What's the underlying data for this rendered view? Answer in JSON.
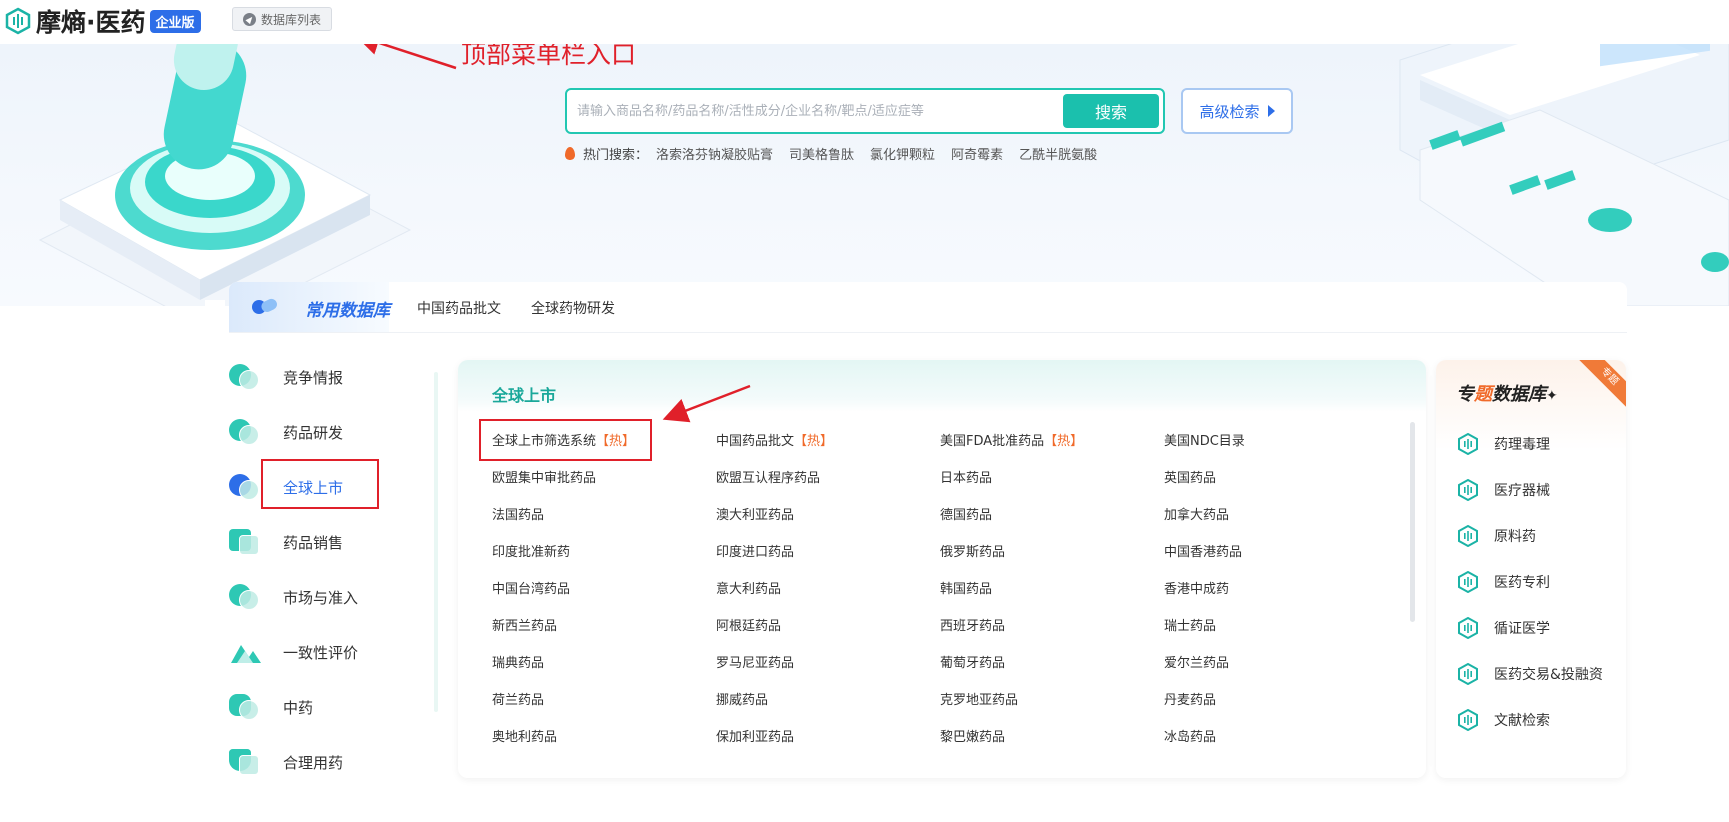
{
  "brand": {
    "name": "摩熵·医药",
    "badge": "企业版"
  },
  "topbar": {
    "db_list_label": "数据库列表"
  },
  "annotation": {
    "note": "顶部菜单栏入口"
  },
  "search": {
    "placeholder": "请输入商品名称/药品名称/活性成分/企业名称/靶点/适应症等",
    "button": "搜索",
    "advanced": "高级检索"
  },
  "hot_search": {
    "label": "热门搜索：",
    "items": [
      "洛索洛芬钠凝胶贴膏",
      "司美格鲁肽",
      "氯化钾颗粒",
      "阿奇霉素",
      "乙酰半胱氨酸"
    ]
  },
  "common_db": {
    "title": "常用数据库",
    "tabs": [
      "中国药品批文",
      "全球药物研发"
    ]
  },
  "left_nav": {
    "items": [
      {
        "label": "竞争情报",
        "active": false
      },
      {
        "label": "药品研发",
        "active": false
      },
      {
        "label": "全球上市",
        "active": true
      },
      {
        "label": "药品销售",
        "active": false
      },
      {
        "label": "市场与准入",
        "active": false
      },
      {
        "label": "一致性评价",
        "active": false
      },
      {
        "label": "中药",
        "active": false
      },
      {
        "label": "合理用药",
        "active": false
      }
    ]
  },
  "main": {
    "title": "全球上市",
    "hot_tag": "【热】",
    "rows": [
      [
        {
          "t": "全球上市筛选系统",
          "hot": true
        },
        {
          "t": "中国药品批文",
          "hot": true
        },
        {
          "t": "美国FDA批准药品",
          "hot": true
        },
        {
          "t": "美国NDC目录",
          "hot": false
        }
      ],
      [
        {
          "t": "欧盟集中审批药品",
          "hot": false
        },
        {
          "t": "欧盟互认程序药品",
          "hot": false
        },
        {
          "t": "日本药品",
          "hot": false
        },
        {
          "t": "英国药品",
          "hot": false
        }
      ],
      [
        {
          "t": "法国药品",
          "hot": false
        },
        {
          "t": "澳大利亚药品",
          "hot": false
        },
        {
          "t": "德国药品",
          "hot": false
        },
        {
          "t": "加拿大药品",
          "hot": false
        }
      ],
      [
        {
          "t": "印度批准新药",
          "hot": false
        },
        {
          "t": "印度进口药品",
          "hot": false
        },
        {
          "t": "俄罗斯药品",
          "hot": false
        },
        {
          "t": "中国香港药品",
          "hot": false
        }
      ],
      [
        {
          "t": "中国台湾药品",
          "hot": false
        },
        {
          "t": "意大利药品",
          "hot": false
        },
        {
          "t": "韩国药品",
          "hot": false
        },
        {
          "t": "香港中成药",
          "hot": false
        }
      ],
      [
        {
          "t": "新西兰药品",
          "hot": false
        },
        {
          "t": "阿根廷药品",
          "hot": false
        },
        {
          "t": "西班牙药品",
          "hot": false
        },
        {
          "t": "瑞士药品",
          "hot": false
        }
      ],
      [
        {
          "t": "瑞典药品",
          "hot": false
        },
        {
          "t": "罗马尼亚药品",
          "hot": false
        },
        {
          "t": "葡萄牙药品",
          "hot": false
        },
        {
          "t": "爱尔兰药品",
          "hot": false
        }
      ],
      [
        {
          "t": "荷兰药品",
          "hot": false
        },
        {
          "t": "挪威药品",
          "hot": false
        },
        {
          "t": "克罗地亚药品",
          "hot": false
        },
        {
          "t": "丹麦药品",
          "hot": false
        }
      ],
      [
        {
          "t": "奥地利药品",
          "hot": false
        },
        {
          "t": "保加利亚药品",
          "hot": false
        },
        {
          "t": "黎巴嫩药品",
          "hot": false
        },
        {
          "t": "冰岛药品",
          "hot": false
        }
      ]
    ]
  },
  "special_db": {
    "title_pre": "专",
    "title_orange": "题",
    "title_post": "数据库",
    "corner": "专题",
    "items": [
      "药理毒理",
      "医疗器械",
      "原料药",
      "医药专利",
      "循证医学",
      "医药交易&投融资",
      "文献检索"
    ]
  },
  "colors": {
    "teal": "#1bc0ad",
    "blue": "#2d6ee8",
    "red_annotation": "#e0202a",
    "hot_orange": "#f06a2a"
  }
}
